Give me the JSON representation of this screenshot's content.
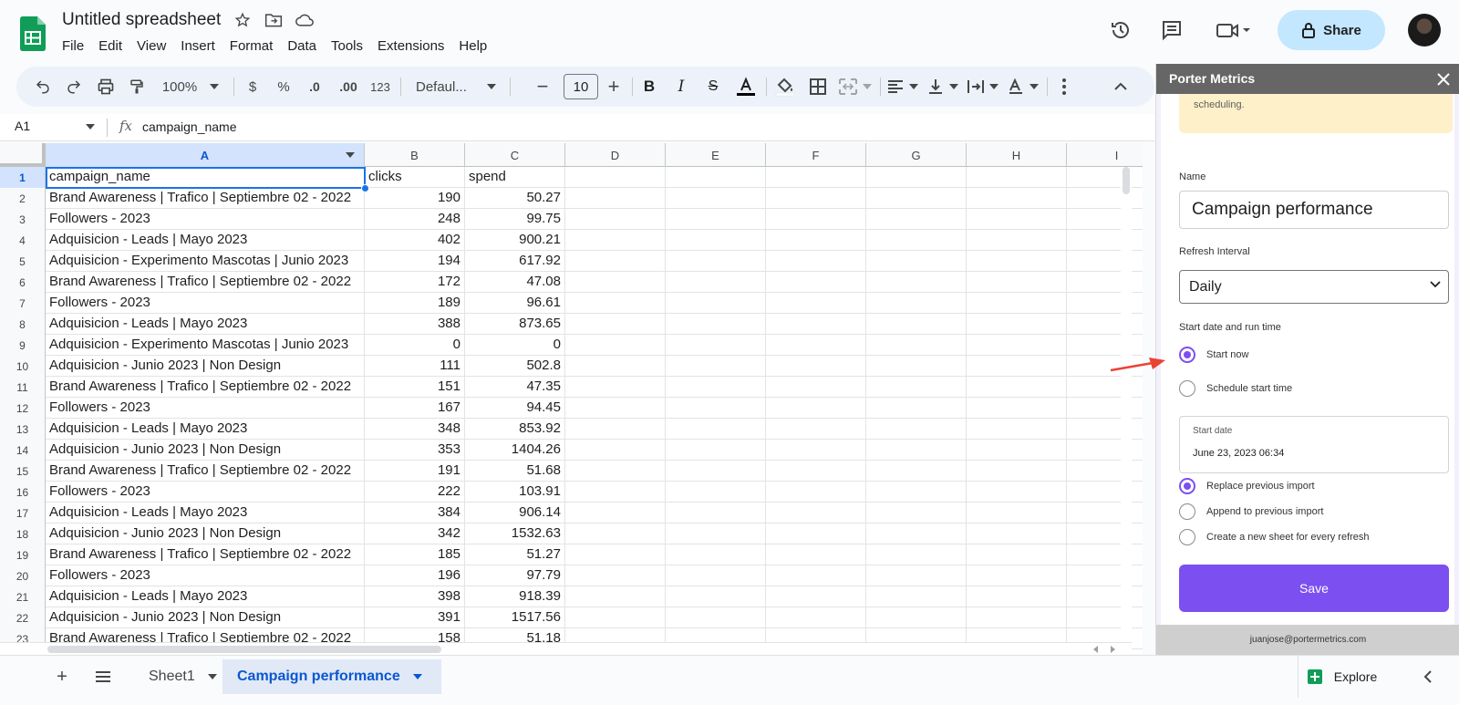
{
  "app": {
    "doc_title": "Untitled spreadsheet",
    "share_label": "Share",
    "menu": [
      "File",
      "Edit",
      "View",
      "Insert",
      "Format",
      "Data",
      "Tools",
      "Extensions",
      "Help"
    ]
  },
  "toolbar": {
    "zoom": "100%",
    "currency": "$",
    "percent": "%",
    "decrease_decimal": ".0",
    "increase_decimal": ".00",
    "more_formats": "123",
    "font": "Defaul...",
    "font_size": "10"
  },
  "formula_bar": {
    "cell_ref": "A1",
    "fx": "fx",
    "value": "campaign_name"
  },
  "grid": {
    "columns": [
      "A",
      "B",
      "C",
      "D",
      "E",
      "F",
      "G",
      "H",
      "I"
    ],
    "rows": [
      {
        "n": "1",
        "a": "campaign_name",
        "b": "clicks",
        "c": "spend"
      },
      {
        "n": "2",
        "a": "Brand Awareness | Trafico | Septiembre 02 - 2022",
        "b": "190",
        "c": "50.27"
      },
      {
        "n": "3",
        "a": "Followers - 2023",
        "b": "248",
        "c": "99.75"
      },
      {
        "n": "4",
        "a": "Adquisicion - Leads | Mayo 2023",
        "b": "402",
        "c": "900.21"
      },
      {
        "n": "5",
        "a": "Adquisicion - Experimento Mascotas | Junio 2023",
        "b": "194",
        "c": "617.92"
      },
      {
        "n": "6",
        "a": "Brand Awareness | Trafico | Septiembre 02 - 2022",
        "b": "172",
        "c": "47.08"
      },
      {
        "n": "7",
        "a": "Followers - 2023",
        "b": "189",
        "c": "96.61"
      },
      {
        "n": "8",
        "a": "Adquisicion - Leads | Mayo 2023",
        "b": "388",
        "c": "873.65"
      },
      {
        "n": "9",
        "a": "Adquisicion - Experimento Mascotas | Junio 2023",
        "b": "0",
        "c": "0"
      },
      {
        "n": "10",
        "a": "Adquisicion - Junio 2023 | Non Design",
        "b": "111",
        "c": "502.8"
      },
      {
        "n": "11",
        "a": "Brand Awareness | Trafico | Septiembre 02 - 2022",
        "b": "151",
        "c": "47.35"
      },
      {
        "n": "12",
        "a": "Followers - 2023",
        "b": "167",
        "c": "94.45"
      },
      {
        "n": "13",
        "a": "Adquisicion - Leads | Mayo 2023",
        "b": "348",
        "c": "853.92"
      },
      {
        "n": "14",
        "a": "Adquisicion - Junio 2023 | Non Design",
        "b": "353",
        "c": "1404.26"
      },
      {
        "n": "15",
        "a": "Brand Awareness | Trafico | Septiembre 02 - 2022",
        "b": "191",
        "c": "51.68"
      },
      {
        "n": "16",
        "a": "Followers - 2023",
        "b": "222",
        "c": "103.91"
      },
      {
        "n": "17",
        "a": "Adquisicion - Leads | Mayo 2023",
        "b": "384",
        "c": "906.14"
      },
      {
        "n": "18",
        "a": "Adquisicion - Junio 2023 | Non Design",
        "b": "342",
        "c": "1532.63"
      },
      {
        "n": "19",
        "a": "Brand Awareness | Trafico | Septiembre 02 - 2022",
        "b": "185",
        "c": "51.27"
      },
      {
        "n": "20",
        "a": "Followers - 2023",
        "b": "196",
        "c": "97.79"
      },
      {
        "n": "21",
        "a": "Adquisicion - Leads | Mayo 2023",
        "b": "398",
        "c": "918.39"
      },
      {
        "n": "22",
        "a": "Adquisicion - Junio 2023 | Non Design",
        "b": "391",
        "c": "1517.56"
      },
      {
        "n": "23",
        "a": "Brand Awareness | Trafico | Septiembre 02 - 2022",
        "b": "158",
        "c": "51.18"
      }
    ]
  },
  "sheets": {
    "tabs": [
      {
        "label": "Sheet1",
        "active": false
      },
      {
        "label": "Campaign performance",
        "active": true
      }
    ],
    "explore_label": "Explore"
  },
  "panel": {
    "title": "Porter Metrics",
    "notice_text": "scheduling.",
    "name_label": "Name",
    "name_value": "Campaign performance",
    "refresh_label": "Refresh Interval",
    "refresh_value": "Daily",
    "start_label": "Start date and run time",
    "start_options": [
      {
        "label": "Start now",
        "selected": true
      },
      {
        "label": "Schedule start time",
        "selected": false
      }
    ],
    "date_label": "Start date",
    "date_value": "June 23, 2023 06:34",
    "import_options": [
      {
        "label": "Replace previous import",
        "selected": true
      },
      {
        "label": "Append to previous import",
        "selected": false
      },
      {
        "label": "Create a new sheet for every refresh",
        "selected": false
      }
    ],
    "save_label": "Save",
    "footer_email": "juanjose@portermetrics.com"
  },
  "colors": {
    "accent": "#7c4ff0",
    "selection_blue": "#1a73e8",
    "share_bg": "#c2e7ff",
    "arrow": "#ea4335"
  }
}
